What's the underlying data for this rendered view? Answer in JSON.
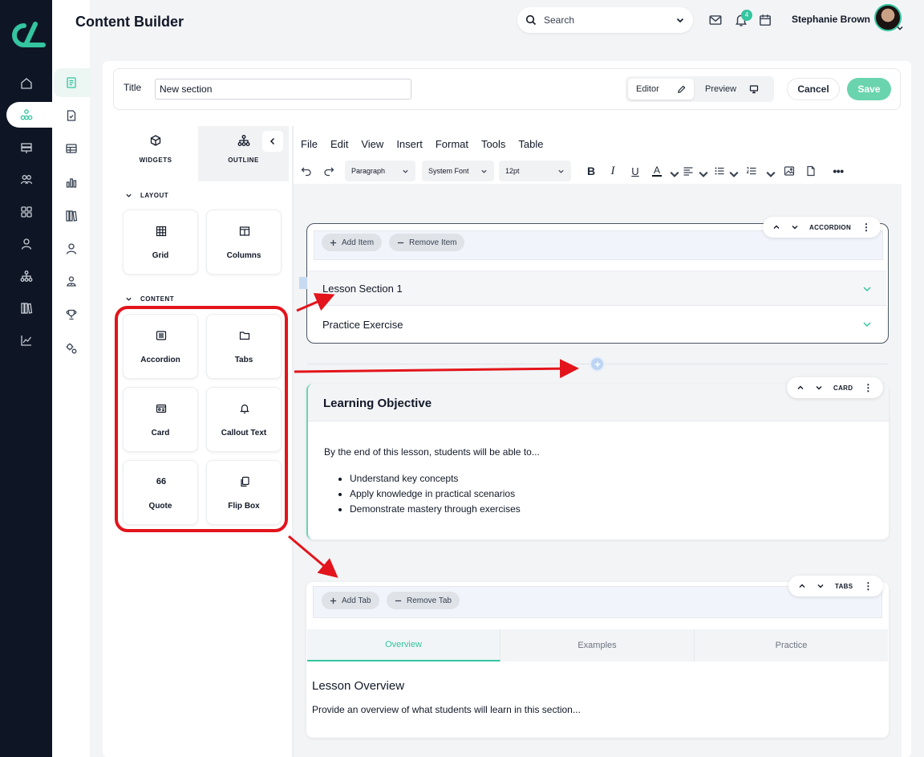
{
  "app": {
    "page_title": "Content Builder"
  },
  "header": {
    "search_placeholder": "Search",
    "notifications_count": "4",
    "user_name": "Stephanie Brown"
  },
  "title_bar": {
    "label": "Title",
    "value": "New section",
    "editor_label": "Editor",
    "preview_label": "Preview",
    "cancel_label": "Cancel",
    "save_label": "Save"
  },
  "widget_panel": {
    "tabs": [
      {
        "label": "WIDGETS"
      },
      {
        "label": "OUTLINE"
      }
    ],
    "layout_section": "LAYOUT",
    "content_section": "CONTENT",
    "layout_items": [
      {
        "label": "Grid"
      },
      {
        "label": "Columns"
      }
    ],
    "content_items": [
      {
        "label": "Accordion"
      },
      {
        "label": "Tabs"
      },
      {
        "label": "Card"
      },
      {
        "label": "Callout Text"
      },
      {
        "label": "Quote",
        "glyph": "66"
      },
      {
        "label": "Flip Box"
      }
    ]
  },
  "editor": {
    "menu": [
      "File",
      "Edit",
      "View",
      "Insert",
      "Format",
      "Tools",
      "Table"
    ],
    "block_format": "Paragraph",
    "font_family": "System Font",
    "font_size": "12pt"
  },
  "accordion_block": {
    "type_label": "ACCORDION",
    "add_label": "Add Item",
    "remove_label": "Remove Item",
    "items": [
      {
        "title": "Lesson Section 1"
      },
      {
        "title": "Practice Exercise"
      }
    ]
  },
  "card_block": {
    "type_label": "CARD",
    "title": "Learning Objective",
    "intro": "By the end of this lesson, students will be able to...",
    "bullets": [
      "Understand key concepts",
      "Apply knowledge in practical scenarios",
      "Demonstrate mastery through exercises"
    ]
  },
  "tabs_block": {
    "type_label": "TABS",
    "add_label": "Add Tab",
    "remove_label": "Remove Tab",
    "tabs": [
      {
        "label": "Overview"
      },
      {
        "label": "Examples"
      },
      {
        "label": "Practice"
      }
    ],
    "heading": "Lesson Overview",
    "body": "Provide an overview of what students will learn in this section..."
  },
  "colors": {
    "sidebar": "#0e1626",
    "accent": "#34c5a0",
    "save_button": "#6ad4ae",
    "annotation": "#e3141b"
  }
}
